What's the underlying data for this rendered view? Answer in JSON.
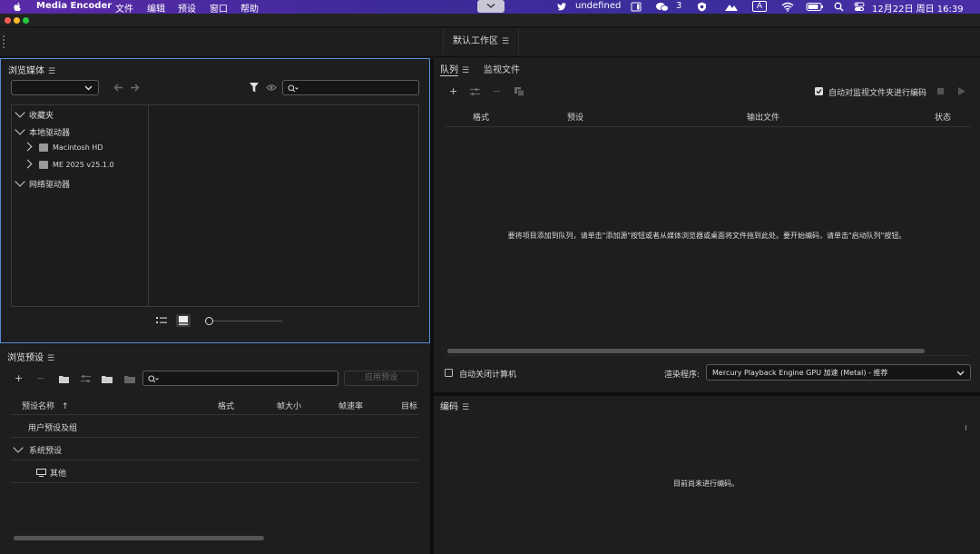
{
  "menubar": {
    "app_name": "Media Encoder",
    "menus": [
      "文件",
      "编辑",
      "预设",
      "窗口",
      "帮助"
    ],
    "status_text": "undefined",
    "wechat_count": "3",
    "input_method": "A",
    "datetime": "12月22日 周日 16:39"
  },
  "workspace": {
    "tab_label": "默认工作区"
  },
  "media_browser": {
    "title": "浏览媒体",
    "search_placeholder": "",
    "tree": {
      "favorites": "收藏夹",
      "local_drives": "本地驱动器",
      "drive1": "Macintosh HD",
      "drive2": "ME 2025 v25.1.0",
      "network_drives": "网络驱动器"
    }
  },
  "preset_browser": {
    "title": "浏览预设",
    "apply_label": "应用预设",
    "columns": {
      "name": "预设名称",
      "sort_arrow": "↑",
      "format": "格式",
      "frame_size": "帧大小",
      "frame_rate": "帧速率",
      "target": "目标"
    },
    "rows": {
      "user_presets": "用户预设及组",
      "system_presets": "系统预设",
      "other": "其他"
    }
  },
  "queue": {
    "tab_queue": "队列",
    "tab_watch": "监视文件",
    "auto_encode_label": "自动对监视文件夹进行编码",
    "columns": {
      "format": "格式",
      "preset": "预设",
      "output": "输出文件",
      "status": "状态"
    },
    "empty_message": "要将项目添加到队列，请单击\"添加源\"按钮或者从媒体浏览器或桌面将文件拖到此处。要开始编码，请单击\"启动队列\"按钮。",
    "auto_shutdown_label": "自动关闭计算机",
    "renderer_label": "渲染程序:",
    "renderer_value": "Mercury Playback Engine GPU 加速 (Metal) - 推荐"
  },
  "encoding": {
    "title": "编码",
    "empty_message": "目前尚未进行编码。"
  },
  "colors": {
    "menubar_bg": "#4a2ea6",
    "panel_bg": "#1e1e1e",
    "active_panel_border": "#5a8bd8"
  }
}
